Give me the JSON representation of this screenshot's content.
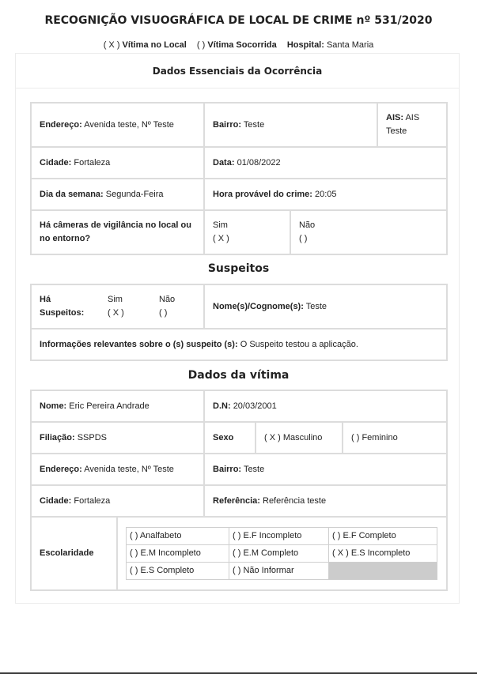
{
  "header": {
    "title": "RECOGNIÇÃO VISUOGRÁFICA DE LOCAL DE CRIME nº 531/2020",
    "vitima_local_mark": "( X )",
    "vitima_local_label": "Vítima no Local",
    "vitima_socorrida_mark": "( )",
    "vitima_socorrida_label": "Vítima Socorrida",
    "hospital_label": "Hospital:",
    "hospital_value": "Santa Maria"
  },
  "ocorrencia": {
    "heading": "Dados Essenciais da Ocorrência",
    "endereco_label": "Endereço:",
    "endereco_value": "Avenida teste, Nº Teste",
    "bairro_label": "Bairro:",
    "bairro_value": "Teste",
    "ais_label": "AIS:",
    "ais_value": "AIS Teste",
    "cidade_label": "Cidade:",
    "cidade_value": "Fortaleza",
    "data_label": "Data:",
    "data_value": "01/08/2022",
    "dia_label": "Dia da semana:",
    "dia_value": "Segunda-Feira",
    "hora_label": "Hora provável do crime:",
    "hora_value": "20:05",
    "cameras_label": "Há câmeras de vigilância no local ou no entorno?",
    "sim_label": "Sim",
    "sim_mark": "( X )",
    "nao_label": "Não",
    "nao_mark": "( )"
  },
  "suspeitos": {
    "heading": "Suspeitos",
    "ha_label": "Há Suspeitos:",
    "sim_label": "Sim",
    "sim_mark": "( X )",
    "nao_label": "Não",
    "nao_mark": "( )",
    "nome_label": "Nome(s)/Cognome(s):",
    "nome_value": "Teste",
    "info_label": "Informações relevantes sobre o (s) suspeito (s):",
    "info_value": "O Suspeito testou a aplicação."
  },
  "vitima": {
    "heading": "Dados da vítima",
    "nome_label": "Nome:",
    "nome_value": "Eric Pereira Andrade",
    "dn_label": "D.N:",
    "dn_value": "20/03/2001",
    "filiacao_label": "Filiação:",
    "filiacao_value": "SSPDS",
    "sexo_label": "Sexo",
    "masculino": "( X ) Masculino",
    "feminino": "( ) Feminino",
    "endereco_label": "Endereço:",
    "endereco_value": "Avenida teste, Nº Teste",
    "bairro_label": "Bairro:",
    "bairro_value": "Teste",
    "cidade_label": "Cidade:",
    "cidade_value": "Fortaleza",
    "referencia_label": "Referência:",
    "referencia_value": "Referência teste",
    "escolaridade_label": "Escolaridade",
    "escolaridade_options": [
      "( ) Analfabeto",
      "( ) E.F Incompleto",
      "( ) E.F Completo",
      "( ) E.M Incompleto",
      "( ) E.M Completo",
      "( X ) E.S Incompleto",
      "( ) E.S Completo",
      "( ) Não Informar"
    ]
  }
}
